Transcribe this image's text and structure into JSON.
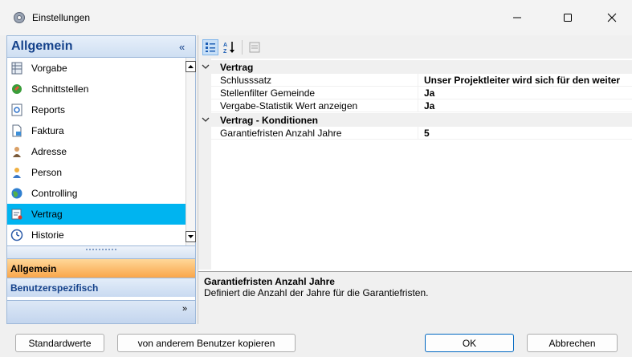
{
  "window": {
    "title": "Einstellungen",
    "controls": {
      "minimize": "—",
      "maximize": "☐",
      "close": "✕"
    }
  },
  "left_panel": {
    "header": "Allgemein",
    "collapse_glyph": "«",
    "items": [
      {
        "label": "Vorgabe",
        "icon": "table-icon",
        "selected": false
      },
      {
        "label": "Schnittstellen",
        "icon": "plug-icon",
        "selected": false
      },
      {
        "label": "Reports",
        "icon": "report-icon",
        "selected": false
      },
      {
        "label": "Faktura",
        "icon": "invoice-icon",
        "selected": false
      },
      {
        "label": "Adresse",
        "icon": "address-person-icon",
        "selected": false
      },
      {
        "label": "Person",
        "icon": "person-icon",
        "selected": false
      },
      {
        "label": "Controlling",
        "icon": "controlling-globe-icon",
        "selected": false
      },
      {
        "label": "Vertrag",
        "icon": "contract-icon",
        "selected": true
      },
      {
        "label": "Historie",
        "icon": "clock-icon",
        "selected": false
      }
    ],
    "groups": [
      {
        "label": "Allgemein",
        "active": true
      },
      {
        "label": "Benutzerspezifisch",
        "active": false
      }
    ],
    "overflow_glyph": "»"
  },
  "toolbar": {
    "buttons": [
      "categorized-icon",
      "sort-az-icon",
      "property-pages-icon"
    ],
    "alpha_label_top": "A",
    "alpha_label_bottom": "Z"
  },
  "property_grid": {
    "categories": [
      {
        "label": "Vertrag",
        "properties": [
          {
            "name": "Schlusssatz",
            "value": "Unser Projektleiter wird sich für den weiter"
          },
          {
            "name": "Stellenfilter Gemeinde",
            "value": "Ja"
          },
          {
            "name": "Vergabe-Statistik Wert anzeigen",
            "value": "Ja"
          }
        ]
      },
      {
        "label": "Vertrag - Konditionen",
        "properties": [
          {
            "name": "Garantiefristen Anzahl Jahre",
            "value": "5"
          }
        ]
      }
    ]
  },
  "description": {
    "title": "Garantiefristen Anzahl Jahre",
    "text": "Definiert die Anzahl der Jahre für die Garantiefristen."
  },
  "buttons": {
    "defaults": "Standardwerte",
    "copy_from_user": "von anderem Benutzer kopieren",
    "ok": "OK",
    "cancel": "Abbrechen"
  },
  "colors": {
    "selection": "#00b4f0",
    "active_group": "#f9a64a",
    "header_text": "#15428b"
  }
}
